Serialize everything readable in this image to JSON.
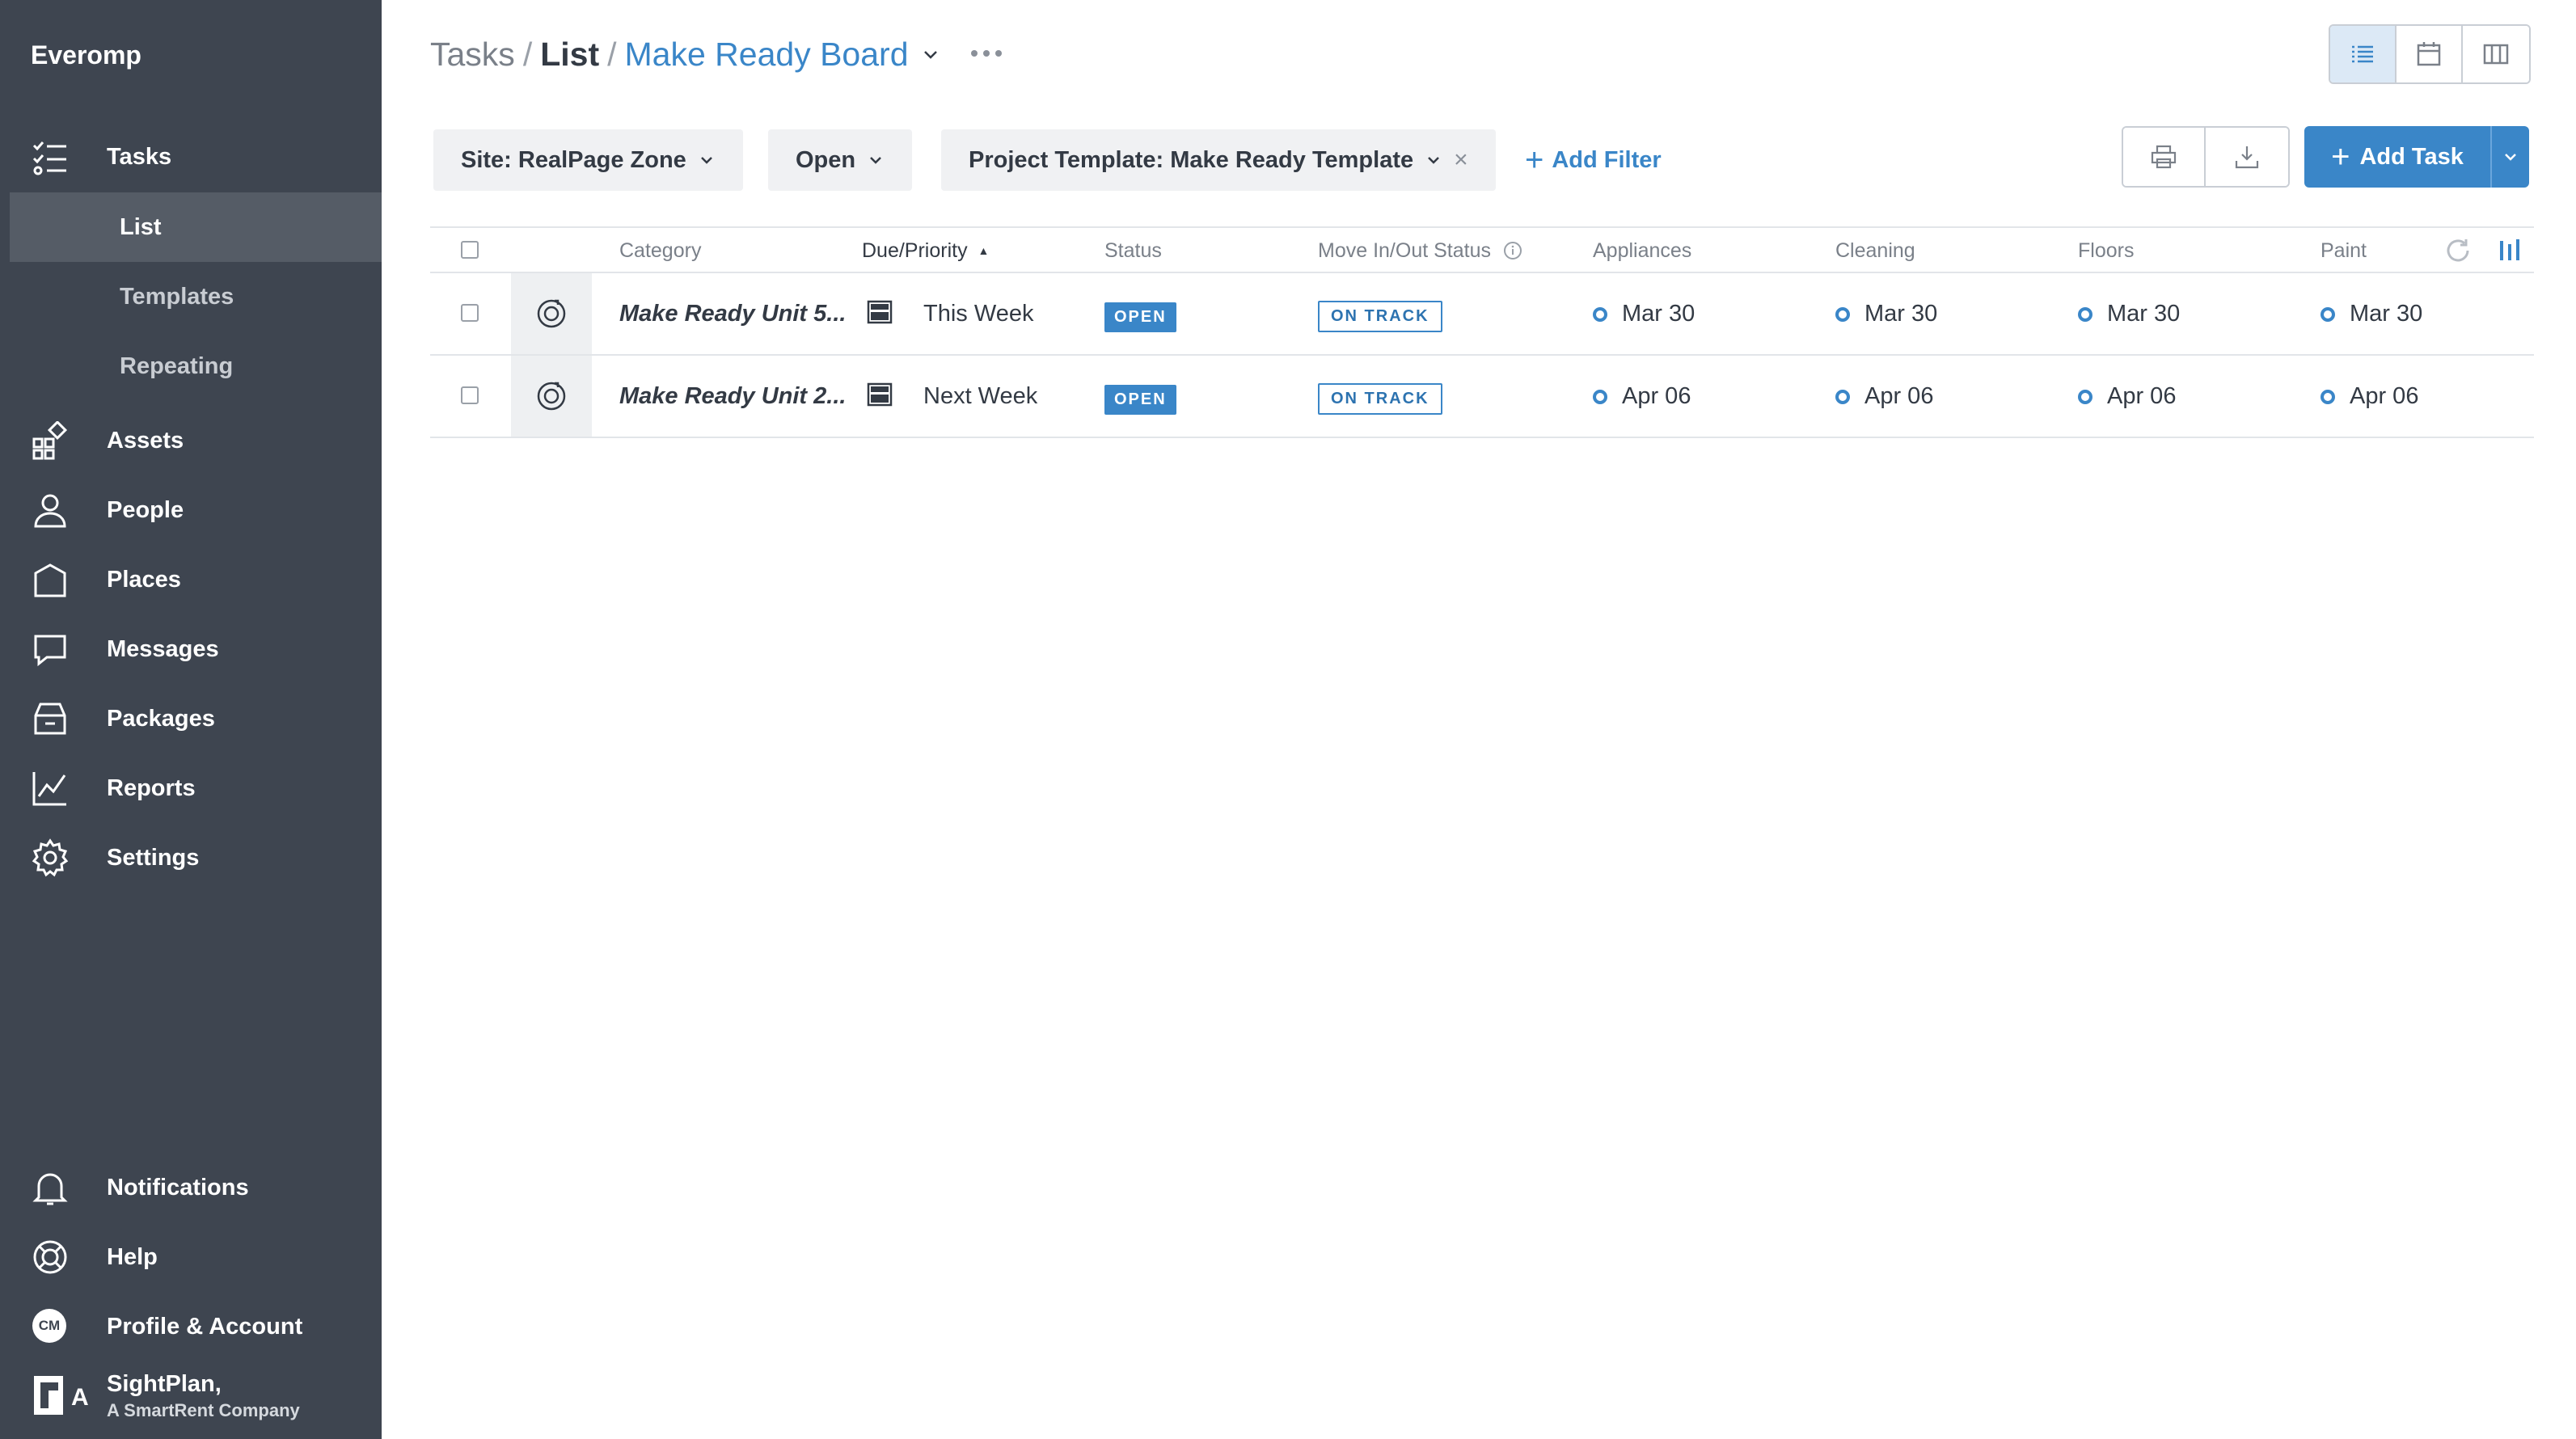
{
  "sidebar": {
    "org_name": "Everomp",
    "nav": {
      "tasks": "Tasks",
      "assets": "Assets",
      "people": "People",
      "places": "Places",
      "messages": "Messages",
      "packages": "Packages",
      "reports": "Reports",
      "settings": "Settings"
    },
    "task_subnav": {
      "list": "List",
      "templates": "Templates",
      "repeating": "Repeating"
    },
    "bottom": {
      "notifications": "Notifications",
      "help": "Help",
      "profile": "Profile & Account",
      "avatar_initials": "CM"
    },
    "brand": {
      "logo_letter": "A",
      "name": "SightPlan,",
      "tagline": "A SmartRent Company"
    }
  },
  "header": {
    "breadcrumb": {
      "root": "Tasks",
      "sep": "/",
      "view": "List",
      "board": "Make Ready Board"
    },
    "more_label": "•••"
  },
  "filters": {
    "site": "Site: RealPage Zone",
    "status": "Open",
    "project_template": "Project Template: Make Ready Template",
    "remove": "×",
    "add_filter": "Add Filter",
    "add_plus": "+"
  },
  "actions": {
    "add_task": "Add Task",
    "add_plus": "+"
  },
  "table": {
    "columns": {
      "category": "Category",
      "due_priority": "Due/Priority",
      "sort_indicator": "▲",
      "status": "Status",
      "move_status": "Move In/Out Status",
      "appliances": "Appliances",
      "cleaning": "Cleaning",
      "floors": "Floors",
      "paint": "Paint"
    },
    "rows": [
      {
        "name": "Make Ready Unit 5...",
        "due": "This Week",
        "status": "OPEN",
        "move_status": "ON TRACK",
        "appliances": "Mar 30",
        "cleaning": "Mar 30",
        "floors": "Mar 30",
        "paint": "Mar 30"
      },
      {
        "name": "Make Ready Unit 2...",
        "due": "Next Week",
        "status": "OPEN",
        "move_status": "ON TRACK",
        "appliances": "Apr 06",
        "cleaning": "Apr 06",
        "floors": "Apr 06",
        "paint": "Apr 06"
      }
    ]
  },
  "colors": {
    "sidebar_bg": "#3e4550",
    "accent": "#3a86c8",
    "active_subitem": "#555c66"
  }
}
